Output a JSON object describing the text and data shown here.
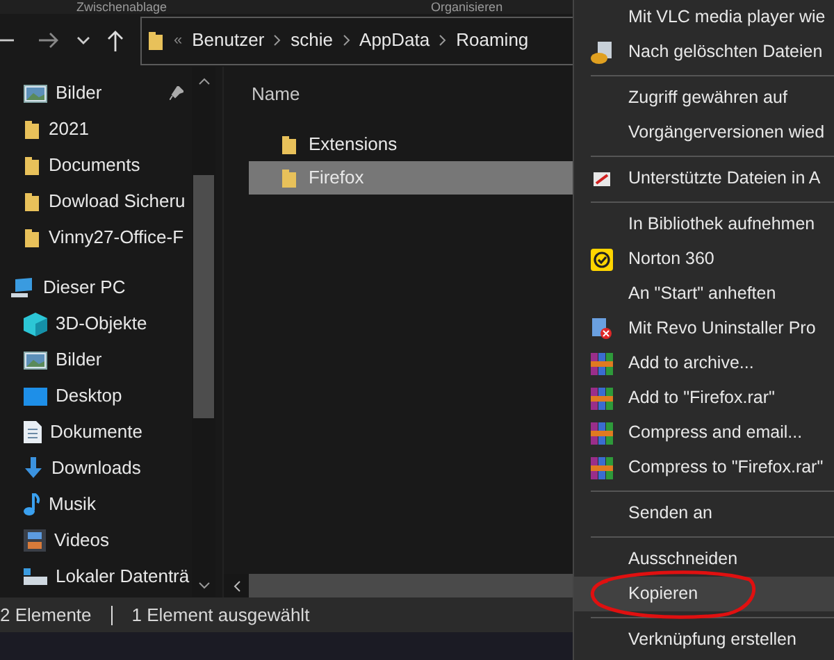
{
  "ribbon_groups": [
    "Zwischenablage",
    "Organisieren"
  ],
  "address_bar": {
    "overflow": "«",
    "segments": [
      "Benutzer",
      "schie",
      "AppData",
      "Roaming"
    ]
  },
  "sidebar": {
    "items": [
      {
        "label": "Bilder",
        "kind": "pictures",
        "pinned": true
      },
      {
        "label": "2021",
        "kind": "folder",
        "pinned": false
      },
      {
        "label": "Documents",
        "kind": "folder",
        "pinned": false
      },
      {
        "label": "Dowload Sicheru",
        "kind": "folder",
        "pinned": false
      },
      {
        "label": "Vinny27-Office-F",
        "kind": "folder",
        "pinned": false
      },
      {
        "label": "Dieser PC",
        "kind": "pc",
        "pinned": false
      },
      {
        "label": "3D-Objekte",
        "kind": "cube",
        "pinned": false
      },
      {
        "label": "Bilder",
        "kind": "pictures",
        "pinned": false
      },
      {
        "label": "Desktop",
        "kind": "desktop",
        "pinned": false
      },
      {
        "label": "Dokumente",
        "kind": "documents",
        "pinned": false
      },
      {
        "label": "Downloads",
        "kind": "downloads",
        "pinned": false
      },
      {
        "label": "Musik",
        "kind": "music",
        "pinned": false
      },
      {
        "label": "Videos",
        "kind": "videos",
        "pinned": false
      },
      {
        "label": "Lokaler Datenträ",
        "kind": "drive",
        "pinned": false
      }
    ]
  },
  "file_list": {
    "column": "Name",
    "rows": [
      {
        "name": "Extensions",
        "selected": false
      },
      {
        "name": "Firefox",
        "selected": true
      }
    ]
  },
  "status_bar": [
    "2 Elemente",
    "1 Element ausgewählt"
  ],
  "context_menu": [
    {
      "kind": "plain",
      "label": "Mit VLC media player wie",
      "selected": false,
      "circled": false
    },
    {
      "kind": "recovery",
      "label": "Nach gelöschten Dateien",
      "selected": false,
      "circled": false
    },
    {
      "kind": "separator"
    },
    {
      "kind": "plain",
      "label": "Zugriff gewähren auf",
      "selected": false,
      "circled": false
    },
    {
      "kind": "plain",
      "label": "Vorgängerversionen wied",
      "selected": false,
      "circled": false
    },
    {
      "kind": "separator"
    },
    {
      "kind": "document",
      "label": "Unterstützte Dateien in A",
      "selected": false,
      "circled": false
    },
    {
      "kind": "separator"
    },
    {
      "kind": "plain",
      "label": "In Bibliothek aufnehmen",
      "selected": false,
      "circled": false
    },
    {
      "kind": "badge",
      "label": "Norton 360",
      "selected": false,
      "circled": false
    },
    {
      "kind": "plain",
      "label": "An \"Start\" anheften",
      "selected": false,
      "circled": false
    },
    {
      "kind": "uninstall",
      "label": "Mit Revo Uninstaller Pro",
      "selected": false,
      "circled": false
    },
    {
      "kind": "archive",
      "label": "Add to archive...",
      "selected": false,
      "circled": false
    },
    {
      "kind": "archive",
      "label": "Add to \"Firefox.rar\"",
      "selected": false,
      "circled": false
    },
    {
      "kind": "archive",
      "label": "Compress and email...",
      "selected": false,
      "circled": false
    },
    {
      "kind": "archive",
      "label": "Compress to \"Firefox.rar\"",
      "selected": false,
      "circled": false
    },
    {
      "kind": "separator"
    },
    {
      "kind": "plain",
      "label": "Senden an",
      "selected": false,
      "circled": false
    },
    {
      "kind": "separator"
    },
    {
      "kind": "plain",
      "label": "Ausschneiden",
      "selected": false,
      "circled": false
    },
    {
      "kind": "plain",
      "label": "Kopieren",
      "selected": true,
      "circled": true
    },
    {
      "kind": "separator"
    },
    {
      "kind": "plain",
      "label": "Verknüpfung erstellen",
      "selected": false,
      "circled": false
    }
  ]
}
